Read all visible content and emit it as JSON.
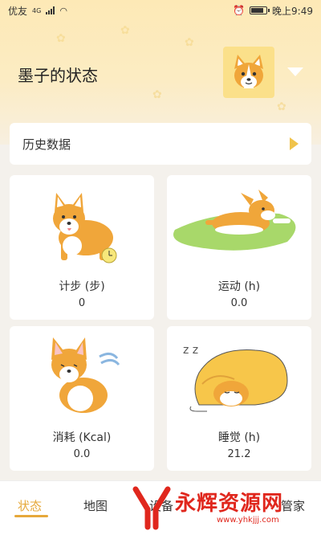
{
  "status_bar": {
    "carrier": "优友",
    "network": "4G",
    "time": "晚上9:49"
  },
  "header": {
    "title": "墨子的状态"
  },
  "history": {
    "label": "历史数据"
  },
  "cards": [
    {
      "label": "计步 (步)",
      "value": "0"
    },
    {
      "label": "运动 (h)",
      "value": "0.0"
    },
    {
      "label": "消耗 (Kcal)",
      "value": "0.0"
    },
    {
      "label": "睡觉 (h)",
      "value": "21.2"
    }
  ],
  "nav": {
    "items": [
      "状态",
      "地图",
      "设备",
      "管家"
    ],
    "active": "状态"
  },
  "watermark": {
    "text": "永辉资源网",
    "url": "www.yhkjjj.com"
  },
  "colors": {
    "accent": "#e6a83a",
    "header": "#fde9b6",
    "corgi": "#f0a63a"
  }
}
